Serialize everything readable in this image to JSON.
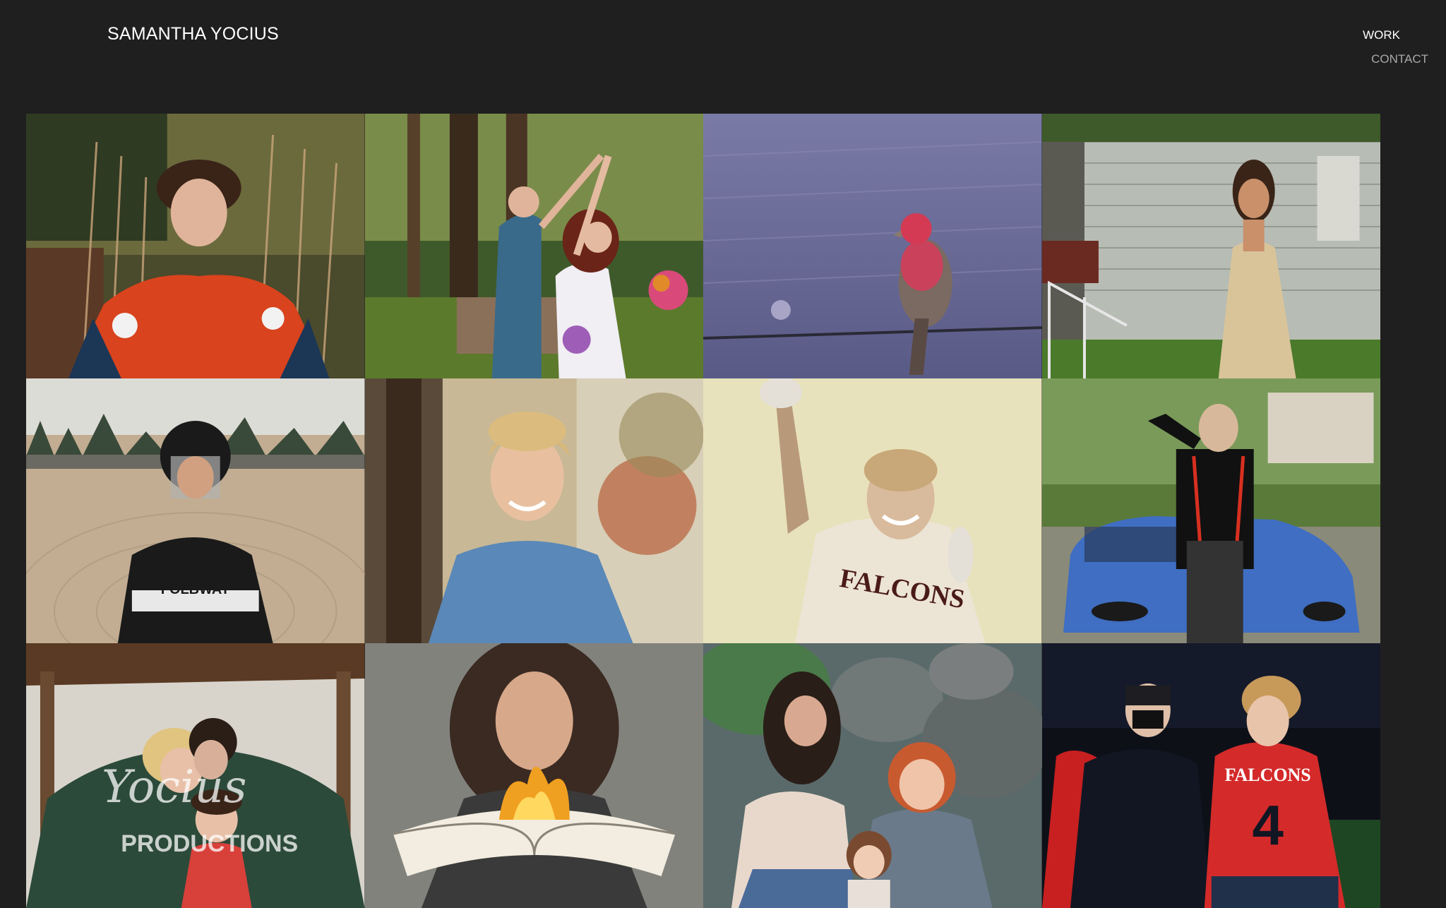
{
  "header": {
    "site_title": "SAMANTHA YOCIUS",
    "nav": [
      {
        "label": "WORK",
        "active": true
      },
      {
        "label": "CONTACT",
        "active": false
      }
    ]
  },
  "gallery": {
    "tiles": [
      {
        "subject": "senior portrait in red varsity jacket among tall grasses"
      },
      {
        "subject": "couple dancing in forest, woman holding bouquet"
      },
      {
        "subject": "red house finch perched on wire"
      },
      {
        "subject": "woman in gold gown beside white house"
      },
      {
        "subject": "softball catcher in helmet on field"
      },
      {
        "subject": "smiling young man in blue shirt by tree"
      },
      {
        "subject": "football player in Falcons jersey celebrating"
      },
      {
        "subject": "young man in suspenders posing on blue car"
      },
      {
        "subject": "family kissing under blanket in pavilion"
      },
      {
        "subject": "woman holding burning book"
      },
      {
        "subject": "mother and daughters sitting on rocks"
      },
      {
        "subject": "two young men at football game, Falcons jersey number 4"
      }
    ],
    "tile_texts": {
      "jersey_1": "FOLBWAY",
      "jersey_2": "FALCONS",
      "jersey_3": "FALCONS",
      "jersey_number": "4",
      "watermark_script": "Yocius",
      "watermark_block": "PRODUCTIONS"
    }
  },
  "colors": {
    "background": "#1f1f1f",
    "title": "#ffffff",
    "nav_active": "#ffffff",
    "nav_inactive": "#a8a8a8"
  }
}
